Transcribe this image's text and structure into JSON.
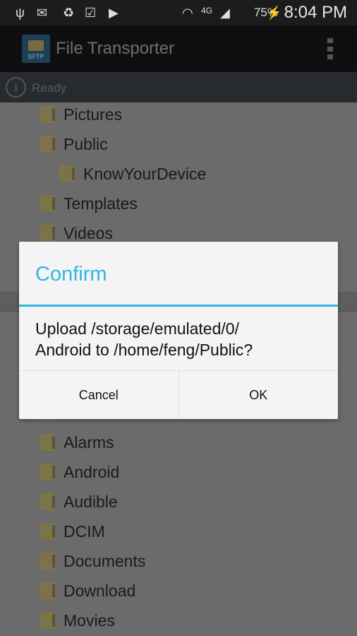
{
  "status_bar": {
    "time": "8:04 PM",
    "battery": "75%",
    "network": "4G",
    "icons": [
      "usb-icon",
      "gmail-icon",
      "recycle-icon",
      "briefcase-check-icon",
      "media-icon",
      "wifi-icon",
      "signal-icon",
      "battery-charging-icon"
    ]
  },
  "app_bar": {
    "logo_text": "SFTP",
    "title": "File Transporter"
  },
  "status": {
    "text": "Ready"
  },
  "remote_list": [
    {
      "name": "Pictures",
      "level": 0
    },
    {
      "name": "Public",
      "level": 0
    },
    {
      "name": "KnowYourDevice",
      "level": 1
    },
    {
      "name": "Templates",
      "level": 0
    },
    {
      "name": "Videos",
      "level": 0
    }
  ],
  "local_list": [
    "Alarms",
    "Android",
    "Audible",
    "DCIM",
    "Documents",
    "Download",
    "Movies"
  ],
  "dialog": {
    "title": "Confirm",
    "message_line1": "Upload /storage/emulated/0/",
    "message_line2": "Android to /home/feng/Public?",
    "cancel": "Cancel",
    "ok": "OK"
  },
  "colors": {
    "accent": "#33b5e5"
  }
}
